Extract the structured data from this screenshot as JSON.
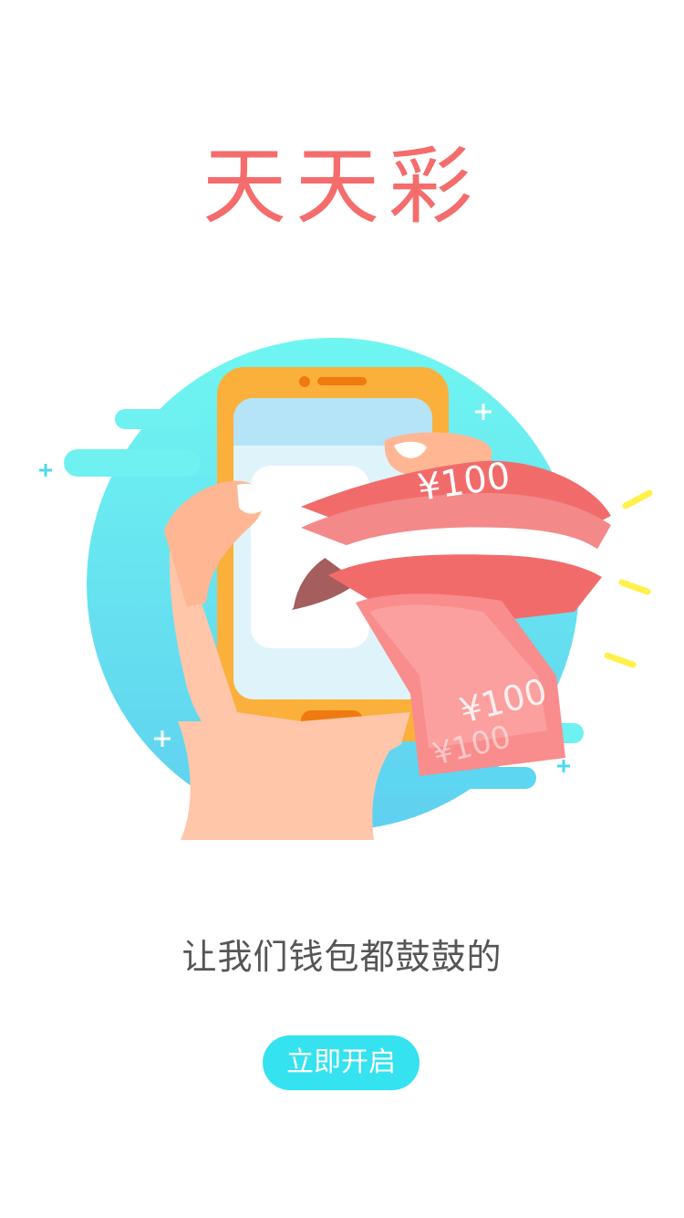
{
  "app": {
    "title": "天天彩"
  },
  "illustration": {
    "note_value_top": "¥100",
    "note_value_middle": "¥100",
    "note_value_bottom": "¥100"
  },
  "tagline": "让我们钱包都鼓鼓的",
  "start_button": {
    "label": "立即开启"
  },
  "colors": {
    "title": "#f46c6c",
    "accent": "#35e2f0",
    "phone": "#fbb03b",
    "note": "#f26b6b"
  }
}
